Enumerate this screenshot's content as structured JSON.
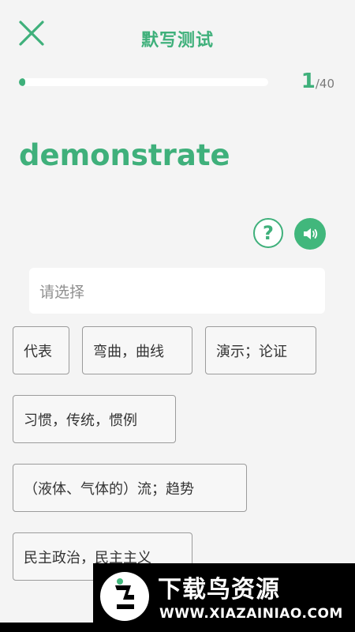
{
  "header": {
    "title": "默写测试",
    "close_icon": "close-icon"
  },
  "progress": {
    "current": "1",
    "total": "/40",
    "fraction": 0.025,
    "color": "#3fb07b"
  },
  "word": "demonstrate",
  "actions": {
    "hint_icon": "question-icon",
    "hint_label": "?",
    "audio_icon": "speaker-icon"
  },
  "answer": {
    "placeholder": "请选择"
  },
  "options": [
    "代表",
    "弯曲，曲线",
    "演示；论证",
    "习惯，传统，惯例",
    "（液体、气体的）流；趋势",
    "民主政治，民主主义"
  ],
  "watermark": {
    "brand": "下载鸟资源",
    "url": "WWW.XIAZAINIAO.COM"
  },
  "colors": {
    "accent": "#3fb07b",
    "background": "#f4f4f4",
    "option_border": "#9b9b9b"
  }
}
